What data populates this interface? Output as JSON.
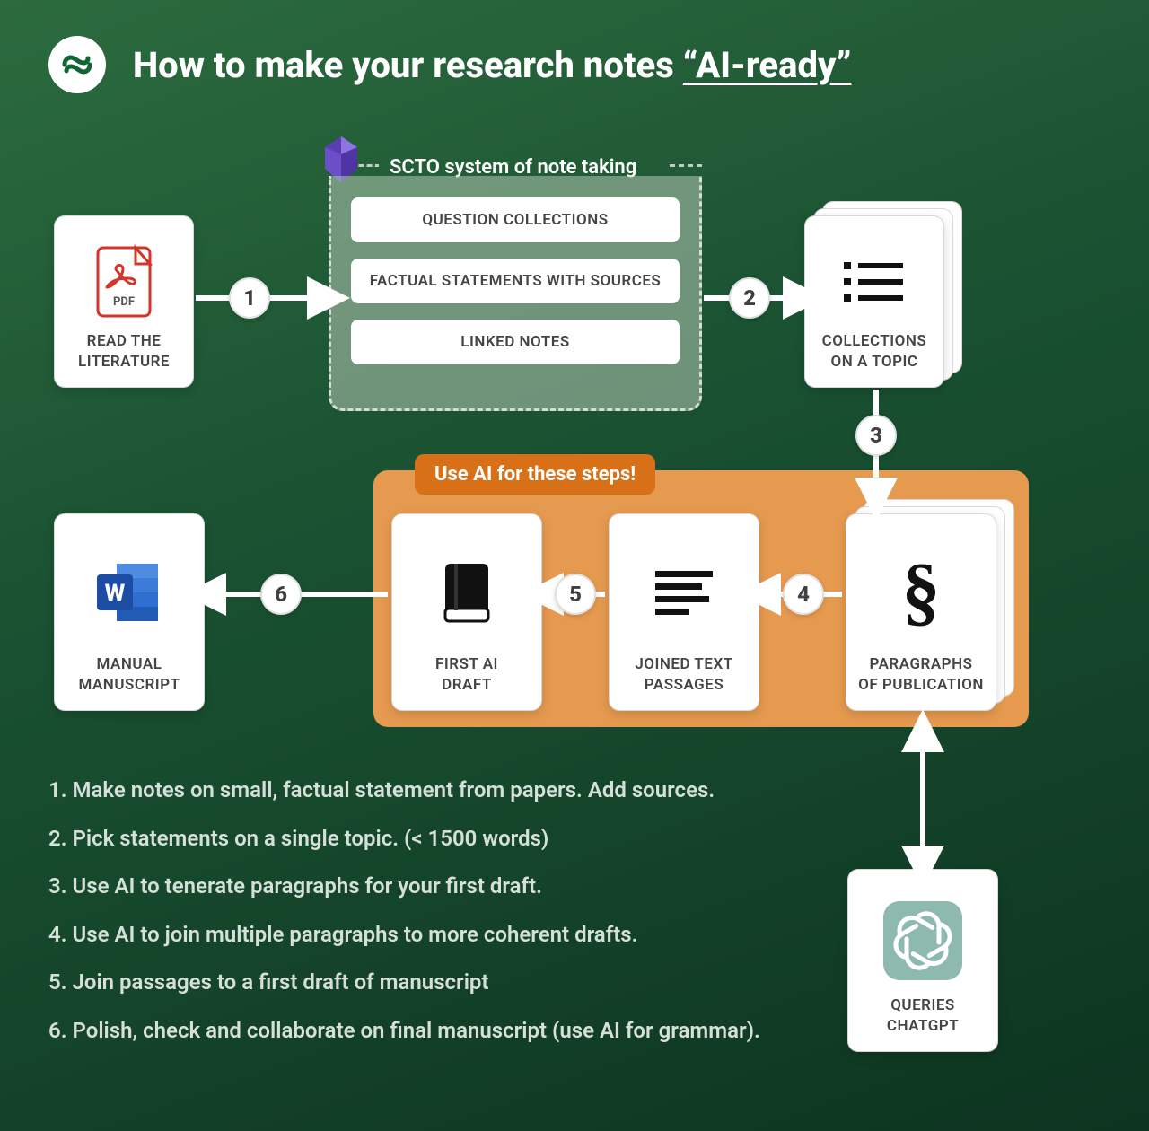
{
  "header": {
    "title_prefix": "How to make your research notes",
    "title_quoted": "“AI-ready”"
  },
  "scto": {
    "header": "SCTO system of note taking",
    "items": [
      "QUESTION COLLECTIONS",
      "FACTUAL STATEMENTS WITH SOURCES",
      "LINKED NOTES"
    ]
  },
  "ai_box": {
    "tag": "Use AI for these steps!"
  },
  "cards": {
    "read_lit": "READ THE\nLITERATURE",
    "collections": "COLLECTIONS\nON A TOPIC",
    "paragraphs": "PARAGRAPHS\nOF PUBLICATION",
    "joined": "JOINED TEXT\nPASSAGES",
    "first_draft": "FIRST AI\nDRAFT",
    "manual": "MANUAL\nMANUSCRIPT",
    "chatgpt": "QUERIES\nCHATGPT"
  },
  "badges": {
    "b1": "1",
    "b2": "2",
    "b3": "3",
    "b4": "4",
    "b5": "5",
    "b6": "6"
  },
  "steps": [
    "1. Make notes on small, factual statement from papers. Add sources.",
    "2. Pick statements on a single topic. (< 1500 words)",
    "3. Use AI to tenerate paragraphs for your first draft.",
    "4. Use AI to join multiple paragraphs to more coherent drafts.",
    "5. Join passages to a first draft of manuscript",
    "6. Polish, check and collaborate on final manuscript (use AI for grammar)."
  ],
  "colors": {
    "accent_orange": "#d87017",
    "ai_box": "#e69a4f"
  }
}
